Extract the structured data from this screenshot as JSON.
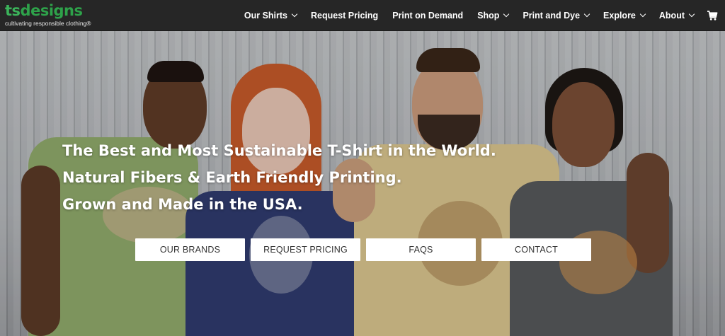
{
  "brand": {
    "logo_ts": "ts",
    "logo_designs": "designs",
    "tagline": "cultivating responsible clothing®"
  },
  "nav": {
    "items": [
      {
        "label": "Our Shirts",
        "dropdown": true
      },
      {
        "label": "Request Pricing",
        "dropdown": false
      },
      {
        "label": "Print on Demand",
        "dropdown": false
      },
      {
        "label": "Shop",
        "dropdown": true
      },
      {
        "label": "Print and Dye",
        "dropdown": true
      },
      {
        "label": "Explore",
        "dropdown": true
      },
      {
        "label": "About",
        "dropdown": true
      }
    ],
    "cart_icon": "cart-icon"
  },
  "hero": {
    "lines": [
      "The Best and Most Sustainable T-Shirt in the World.",
      "Natural Fibers & Earth Friendly Printing.",
      "Grown and Made in the USA."
    ],
    "buttons": [
      "OUR BRANDS",
      "REQUEST PRICING",
      "FAQS",
      "CONTACT"
    ]
  },
  "colors": {
    "header_bg": "#262626",
    "logo_green": "#2ea24a",
    "button_bg": "#ffffff",
    "button_text": "#333333"
  }
}
